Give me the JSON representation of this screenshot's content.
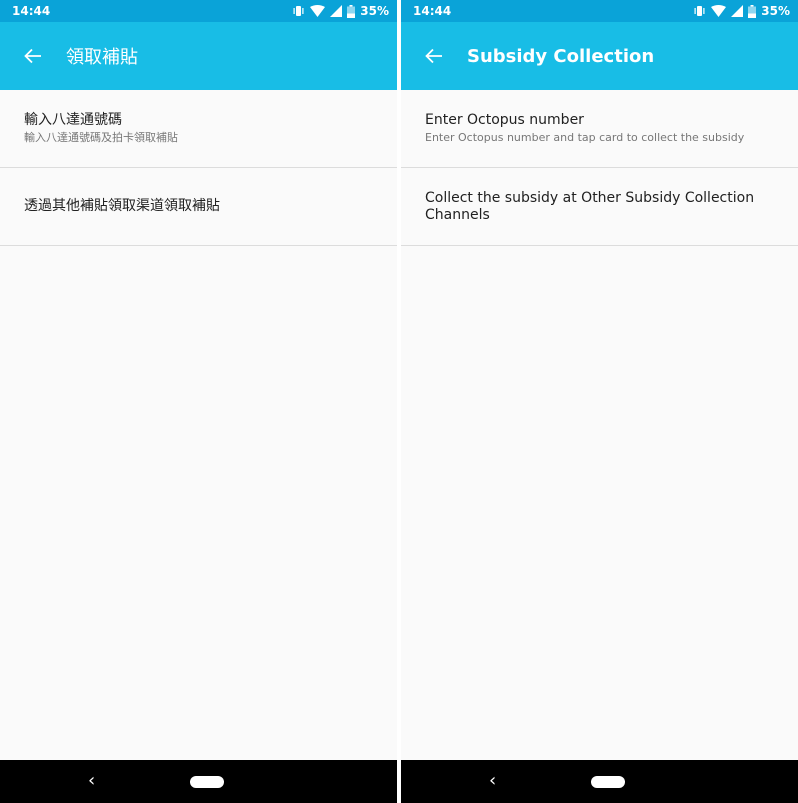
{
  "left": {
    "status": {
      "time": "14:44",
      "battery": "35%"
    },
    "appbar": {
      "title": "領取補貼"
    },
    "items": [
      {
        "title": "輸入八達通號碼",
        "subtitle": "輸入八達通號碼及拍卡領取補貼"
      },
      {
        "title": "透過其他補貼領取渠道領取補貼"
      }
    ]
  },
  "right": {
    "status": {
      "time": "14:44",
      "battery": "35%"
    },
    "appbar": {
      "title": "Subsidy Collection"
    },
    "items": [
      {
        "title": "Enter Octopus number",
        "subtitle": "Enter Octopus number and tap card to collect the subsidy"
      },
      {
        "title": "Collect the subsidy at Other Subsidy Collection Channels"
      }
    ]
  },
  "navbar": {
    "back_glyph": "‹"
  },
  "icons": [
    "vibrate-icon",
    "wifi-icon",
    "signal-icon",
    "battery-icon",
    "arrow-left-icon",
    "nav-home-pill-icon"
  ],
  "colors": {
    "statusbar": "#0aa3d8",
    "appbar": "#18bde6",
    "background": "#fafafa",
    "navbar": "#000000"
  }
}
